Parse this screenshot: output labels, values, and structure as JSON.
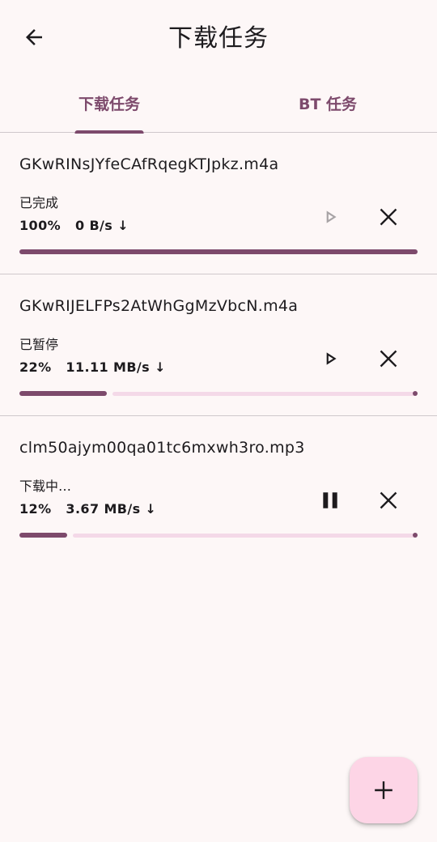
{
  "header": {
    "title": "下载任务",
    "back_icon": "arrow-left-icon"
  },
  "tabs": [
    {
      "label": "下载任务",
      "selected": true
    },
    {
      "label": "BT 任务",
      "selected": false
    }
  ],
  "colors": {
    "accent": "#7d4a6c",
    "track": "#f4d9e8",
    "background": "#fdf7f7",
    "fab": "#fdd5e6",
    "disabled_icon": "#a7a3a5"
  },
  "tasks": [
    {
      "filename": "GKwRINsJYfeCAfRqegKTJpkz.m4a",
      "status": "已完成",
      "percent": "100%",
      "speed": "0 B/s",
      "speed_arrow": "↓",
      "progress": 1.0,
      "action_icon": "play-icon",
      "action_enabled": false,
      "close_icon": "close-icon"
    },
    {
      "filename": "GKwRIJELFPs2AtWhGgMzVbcN.m4a",
      "status": "已暂停",
      "percent": "22%",
      "speed": "11.11 MB/s",
      "speed_arrow": "↓",
      "progress": 0.22,
      "action_icon": "play-icon",
      "action_enabled": true,
      "close_icon": "close-icon"
    },
    {
      "filename": "clm50ajym00qa01tc6mxwh3ro.mp3",
      "status": "下载中…",
      "percent": "12%",
      "speed": "3.67 MB/s",
      "speed_arrow": "↓",
      "progress": 0.12,
      "action_icon": "pause-icon",
      "action_enabled": true,
      "close_icon": "close-icon"
    }
  ],
  "fab": {
    "icon": "plus-icon"
  }
}
